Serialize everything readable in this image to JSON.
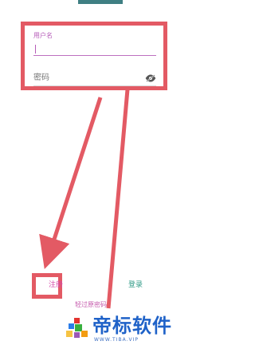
{
  "form": {
    "username_label": "用户名",
    "password_placeholder": "密码"
  },
  "actions": {
    "register": "注册",
    "login": "登录",
    "forgot_password": "轻过原密码"
  },
  "watermark": {
    "title": "帝标软件",
    "subtitle": "WWW.TIBA.VIP"
  },
  "icons": {
    "password_toggle": "eye-slash-icon",
    "watermark_logo": "colorful-squares-logo-icon"
  },
  "colors": {
    "annotation_red": "#e35a64",
    "focus_purple": "#b65cb8",
    "register_pink": "#d54aa8",
    "login_green": "#2f9a86",
    "watermark_blue": "#1f62c8",
    "top_bar": "#3f7f83"
  }
}
